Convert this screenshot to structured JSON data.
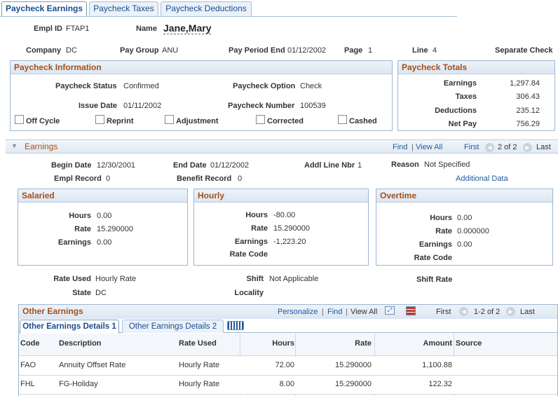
{
  "tabs": [
    {
      "label": "Paycheck Earnings"
    },
    {
      "label": "Paycheck Taxes"
    },
    {
      "label": "Paycheck Deductions"
    }
  ],
  "header": {
    "empl_id_label": "Empl ID",
    "empl_id": "FTAP1",
    "name_label": "Name",
    "name": "Jane,Mary",
    "company_label": "Company",
    "company": "DC",
    "pay_group_label": "Pay Group",
    "pay_group": "ANU",
    "pay_period_end_label": "Pay Period End",
    "pay_period_end": "01/12/2002",
    "page_label": "Page",
    "page": "1",
    "line_label": "Line",
    "line": "4",
    "separate_check": "Separate Check"
  },
  "paycheck_info": {
    "title": "Paycheck Information",
    "status_label": "Paycheck Status",
    "status": "Confirmed",
    "option_label": "Paycheck Option",
    "option": "Check",
    "issue_date_label": "Issue Date",
    "issue_date": "01/11/2002",
    "number_label": "Paycheck Number",
    "number": "100539",
    "checkboxes": [
      {
        "label": "Off Cycle"
      },
      {
        "label": "Reprint"
      },
      {
        "label": "Adjustment"
      },
      {
        "label": "Corrected"
      },
      {
        "label": "Cashed"
      }
    ]
  },
  "paycheck_totals": {
    "title": "Paycheck Totals",
    "rows": [
      {
        "label": "Earnings",
        "value": "1,297.84"
      },
      {
        "label": "Taxes",
        "value": "306.43"
      },
      {
        "label": "Deductions",
        "value": "235.12"
      },
      {
        "label": "Net Pay",
        "value": "756.29"
      }
    ]
  },
  "earnings": {
    "title": "Earnings",
    "find": "Find",
    "view_all": "View All",
    "first": "First",
    "count": "2 of 2",
    "last": "Last",
    "begin_date_label": "Begin Date",
    "begin_date": "12/30/2001",
    "end_date_label": "End Date",
    "end_date": "01/12/2002",
    "addl_line_label": "Addl Line Nbr",
    "addl_line": "1",
    "reason_label": "Reason",
    "reason": "Not Specified",
    "empl_record_label": "Empl Record",
    "empl_record": "0",
    "benefit_record_label": "Benefit Record",
    "benefit_record": "0",
    "additional_data": "Additional Data",
    "salaried": {
      "title": "Salaried",
      "hours_label": "Hours",
      "hours": "0.00",
      "rate_label": "Rate",
      "rate": "15.290000",
      "earnings_label": "Earnings",
      "earnings": "0.00"
    },
    "hourly": {
      "title": "Hourly",
      "hours_label": "Hours",
      "hours": "-80.00",
      "rate_label": "Rate",
      "rate": "15.290000",
      "earnings_label": "Earnings",
      "earnings": "-1,223.20",
      "rate_code_label": "Rate Code"
    },
    "overtime": {
      "title": "Overtime",
      "hours_label": "Hours",
      "hours": "0.00",
      "rate_label": "Rate",
      "rate": "0.000000",
      "earnings_label": "Earnings",
      "earnings": "0.00",
      "rate_code_label": "Rate Code"
    },
    "rate_used_label": "Rate Used",
    "rate_used": "Hourly Rate",
    "shift_label": "Shift",
    "shift": "Not Applicable",
    "shift_rate_label": "Shift Rate",
    "state_label": "State",
    "state": "DC",
    "locality_label": "Locality"
  },
  "other_earnings": {
    "title": "Other Earnings",
    "personalize": "Personalize",
    "find": "Find",
    "view_all": "View All",
    "first": "First",
    "count": "1-2 of 2",
    "last": "Last",
    "subtabs": [
      {
        "label": "Other Earnings Details 1"
      },
      {
        "label": "Other Earnings Details 2"
      }
    ],
    "columns": [
      "Code",
      "Description",
      "Rate Used",
      "Hours",
      "Rate",
      "Amount",
      "Source"
    ],
    "rows": [
      {
        "code": "FAO",
        "description": "Annuity Offset Rate",
        "rate_used": "Hourly Rate",
        "hours": "72.00",
        "rate": "15.290000",
        "amount": "1,100.88",
        "source": ""
      },
      {
        "code": "FHL",
        "description": "FG-Holiday",
        "rate_used": "Hourly Rate",
        "hours": "8.00",
        "rate": "15.290000",
        "amount": "122.32",
        "source": ""
      }
    ]
  },
  "colors": {
    "accent": "#1a4d8f",
    "section_title": "#a3501b",
    "border": "#9cb6d2"
  }
}
